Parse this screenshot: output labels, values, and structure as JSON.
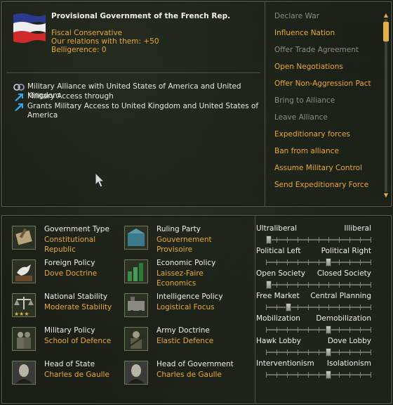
{
  "nation": {
    "title": "Provisional Government of the French Rep.",
    "ideology": "Fiscal Conservative",
    "relations": "Our relations with them: +50",
    "belligerence": "Belligerence: 0"
  },
  "relations_list": [
    {
      "icon": "alliance-icon",
      "text": "Military Alliance with United States of America and United Kingdom"
    },
    {
      "icon": "military-access-arrow-icon",
      "text": "Military Access through"
    },
    {
      "icon": "military-access-arrow-icon",
      "text": "Grants Military Access to United Kingdom and United States of America"
    }
  ],
  "actions": [
    {
      "label": "Declare War",
      "enabled": false
    },
    {
      "label": "Influence Nation",
      "enabled": true
    },
    {
      "label": "Offer Trade Agreement",
      "enabled": false
    },
    {
      "label": "Open Negotiations",
      "enabled": true
    },
    {
      "label": "Offer Non-Aggression Pact",
      "enabled": true
    },
    {
      "label": "Bring to Alliance",
      "enabled": false
    },
    {
      "label": "Leave Alliance",
      "enabled": false
    },
    {
      "label": "Expeditionary forces",
      "enabled": true
    },
    {
      "label": "Ban from alliance",
      "enabled": true
    },
    {
      "label": "Assume Military Control",
      "enabled": true
    },
    {
      "label": "Send Expeditionary Force",
      "enabled": true
    }
  ],
  "government": {
    "left": [
      {
        "label": "Government Type",
        "value": "Constitutional Republic",
        "icon": "government-type-icon"
      },
      {
        "label": "Foreign Policy",
        "value": "Dove Doctrine",
        "icon": "dove-icon"
      },
      {
        "label": "National Stability",
        "value": "Moderate Stability",
        "icon": "scales-icon"
      },
      {
        "label": "Military Policy",
        "value": "School of Defence",
        "icon": "soldiers-icon"
      },
      {
        "label": "Head of State",
        "value": "Charles de Gaulle",
        "icon": "portrait-icon"
      }
    ],
    "right": [
      {
        "label": "Ruling Party",
        "value": "Gouvernement Provisoire",
        "icon": "ruling-party-icon"
      },
      {
        "label": "Economic Policy",
        "value": "Laissez-Faire Economics",
        "icon": "economy-icon"
      },
      {
        "label": "Intelligence Policy",
        "value": "Logistical Focus",
        "icon": "train-icon"
      },
      {
        "label": "Army Doctrine",
        "value": "Elastic Defence",
        "icon": "army-icon"
      },
      {
        "label": "Head of Government",
        "value": "Charles de Gaulle",
        "icon": "portrait-icon"
      }
    ]
  },
  "sliders": [
    {
      "left": "Ultraliberal",
      "right": "Illiberal",
      "position": 0.0
    },
    {
      "left": "Political Left",
      "right": "Political Right",
      "position": 0.6
    },
    {
      "left": "Open Society",
      "right": "Closed Society",
      "position": 0.0
    },
    {
      "left": "Free Market",
      "right": "Central Planning",
      "position": 0.2
    },
    {
      "left": "Mobilization",
      "right": "Demobilization",
      "position": 0.6
    },
    {
      "left": "Hawk Lobby",
      "right": "Dove Lobby",
      "position": 0.6
    },
    {
      "left": "Interventionism",
      "right": "Isolationism",
      "position": 0.6
    }
  ],
  "colors": {
    "accent": "#e7a83a",
    "disabled": "#8c8c84",
    "text": "#f0f0ea"
  }
}
